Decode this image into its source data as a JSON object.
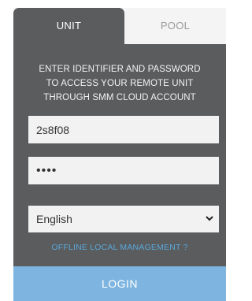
{
  "tabs": {
    "unit_label": "UNIT",
    "pool_label": "POOL",
    "active": "UNIT"
  },
  "instructions": {
    "line1": "ENTER IDENTIFIER AND PASSWORD",
    "line2": "TO ACCESS YOUR REMOTE UNIT",
    "line3": "THROUGH SMM CLOUD ACCOUNT"
  },
  "form": {
    "identifier_value": "2s8f08",
    "password_value": "••••",
    "language_selected": "English"
  },
  "offline_link": "OFFLINE LOCAL MANAGEMENT ?",
  "login_label": "LOGIN",
  "icons": {
    "select_chevron": "chevron-down-icon"
  },
  "colors": {
    "panel": "#5a5c5e",
    "login_button": "#7db5e0",
    "link": "#5aa7d9",
    "inactive_tab": "#f4f4f4"
  }
}
